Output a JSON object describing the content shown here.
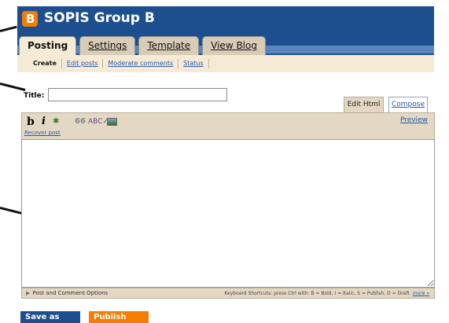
{
  "header": {
    "logo_letter": "B",
    "title": "SOPIS Group B",
    "colors": {
      "header": "#1d4f8f",
      "stripe": "#5a86bf",
      "logo": "#f57d00"
    }
  },
  "tabs": [
    {
      "label": "Posting",
      "active": true
    },
    {
      "label": "Settings",
      "active": false
    },
    {
      "label": "Template",
      "active": false
    },
    {
      "label": "View Blog",
      "active": false
    }
  ],
  "subnav": [
    {
      "label": "Create",
      "current": true
    },
    {
      "label": "Edit posts",
      "current": false
    },
    {
      "label": "Moderate comments",
      "current": false
    },
    {
      "label": "Status",
      "current": false
    }
  ],
  "post_form": {
    "title_label": "Title:",
    "title_value": "",
    "mode_tabs": {
      "edit_html": "Edit Html",
      "compose": "Compose"
    },
    "toolbar": {
      "bold": "b",
      "italic": "i",
      "icons": [
        "link-icon",
        "quote-icon",
        "spellcheck-icon",
        "image-icon"
      ],
      "link_glyph": "✱",
      "quote_glyph": "66",
      "spell_glyph": "ABC✓",
      "recover_post": "Recover post",
      "preview": "Preview"
    },
    "body_value": ""
  },
  "options_bar": {
    "post_comment_options": "Post and Comment Options",
    "shortcuts_text": "Keyboard Shortcuts: press Ctrl with: B = Bold, I = Italic, S = Publish, D = Draft",
    "more_link": "more »"
  },
  "actions": {
    "save_draft": "Save as Draft",
    "publish": "Publish Post"
  }
}
